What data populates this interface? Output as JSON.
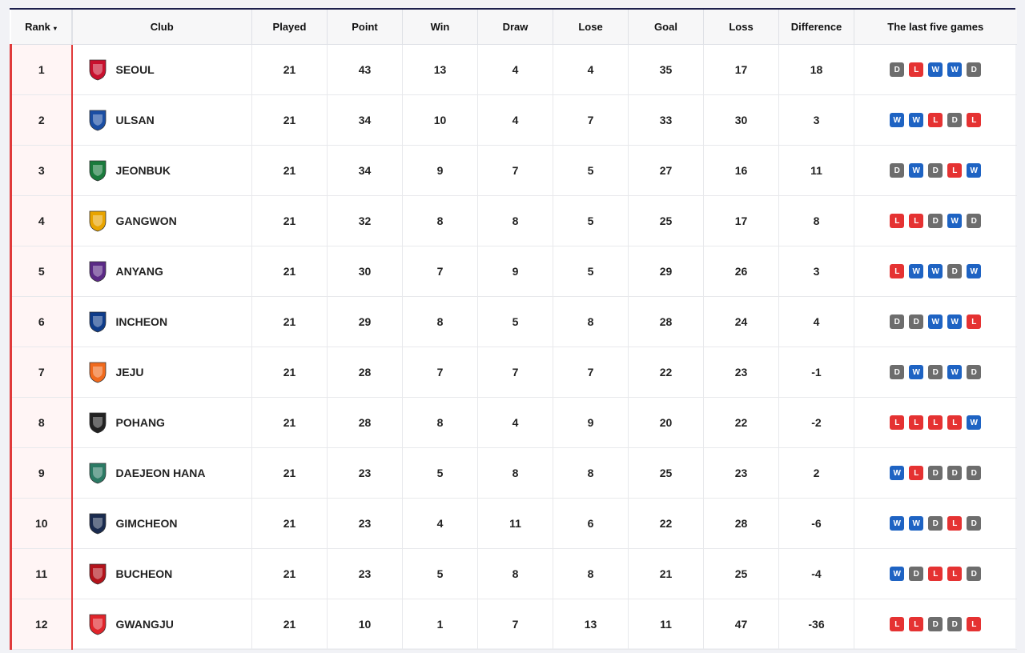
{
  "headers": {
    "rank": "Rank",
    "club": "Club",
    "played": "Played",
    "point": "Point",
    "win": "Win",
    "draw": "Draw",
    "lose": "Lose",
    "goal": "Goal",
    "loss": "Loss",
    "difference": "Difference",
    "form": "The last five games"
  },
  "sort_indicator": "▾",
  "colors": {
    "win": "#1e63c3",
    "loss": "#e53232",
    "draw": "#6d6d6d",
    "accent": "#e03a3a"
  },
  "rows": [
    {
      "rank": "1",
      "club": "SEOUL",
      "crest": "seoul-crest-icon",
      "crest_color": "#c8102e",
      "played": "21",
      "point": "43",
      "win": "13",
      "draw": "4",
      "lose": "4",
      "goal": "35",
      "loss": "17",
      "diff": "18",
      "form": [
        "D",
        "L",
        "W",
        "W",
        "D"
      ]
    },
    {
      "rank": "2",
      "club": "ULSAN",
      "crest": "ulsan-crest-icon",
      "crest_color": "#1b4ea3",
      "played": "21",
      "point": "34",
      "win": "10",
      "draw": "4",
      "lose": "7",
      "goal": "33",
      "loss": "30",
      "diff": "3",
      "form": [
        "W",
        "W",
        "L",
        "D",
        "L"
      ]
    },
    {
      "rank": "3",
      "club": "JEONBUK",
      "crest": "jeonbuk-crest-icon",
      "crest_color": "#1a7a3c",
      "played": "21",
      "point": "34",
      "win": "9",
      "draw": "7",
      "lose": "5",
      "goal": "27",
      "loss": "16",
      "diff": "11",
      "form": [
        "D",
        "W",
        "D",
        "L",
        "W"
      ]
    },
    {
      "rank": "4",
      "club": "GANGWON",
      "crest": "gangwon-crest-icon",
      "crest_color": "#e8a400",
      "played": "21",
      "point": "32",
      "win": "8",
      "draw": "8",
      "lose": "5",
      "goal": "25",
      "loss": "17",
      "diff": "8",
      "form": [
        "L",
        "L",
        "D",
        "W",
        "D"
      ]
    },
    {
      "rank": "5",
      "club": "ANYANG",
      "crest": "anyang-crest-icon",
      "crest_color": "#5b2a86",
      "played": "21",
      "point": "30",
      "win": "7",
      "draw": "9",
      "lose": "5",
      "goal": "29",
      "loss": "26",
      "diff": "3",
      "form": [
        "L",
        "W",
        "W",
        "D",
        "W"
      ]
    },
    {
      "rank": "6",
      "club": "INCHEON",
      "crest": "incheon-crest-icon",
      "crest_color": "#0f3c8a",
      "played": "21",
      "point": "29",
      "win": "8",
      "draw": "5",
      "lose": "8",
      "goal": "28",
      "loss": "24",
      "diff": "4",
      "form": [
        "D",
        "D",
        "W",
        "W",
        "L"
      ]
    },
    {
      "rank": "7",
      "club": "JEJU",
      "crest": "jeju-crest-icon",
      "crest_color": "#f06a1d",
      "played": "21",
      "point": "28",
      "win": "7",
      "draw": "7",
      "lose": "7",
      "goal": "22",
      "loss": "23",
      "diff": "-1",
      "form": [
        "D",
        "W",
        "D",
        "W",
        "D"
      ]
    },
    {
      "rank": "8",
      "club": "POHANG",
      "crest": "pohang-crest-icon",
      "crest_color": "#222222",
      "played": "21",
      "point": "28",
      "win": "8",
      "draw": "4",
      "lose": "9",
      "goal": "20",
      "loss": "22",
      "diff": "-2",
      "form": [
        "L",
        "L",
        "L",
        "L",
        "W"
      ]
    },
    {
      "rank": "9",
      "club": "DAEJEON HANA",
      "crest": "daejeon-crest-icon",
      "crest_color": "#2b7a64",
      "played": "21",
      "point": "23",
      "win": "5",
      "draw": "8",
      "lose": "8",
      "goal": "25",
      "loss": "23",
      "diff": "2",
      "form": [
        "W",
        "L",
        "D",
        "D",
        "D"
      ]
    },
    {
      "rank": "10",
      "club": "GIMCHEON",
      "crest": "gimcheon-crest-icon",
      "crest_color": "#1a2b4f",
      "played": "21",
      "point": "23",
      "win": "4",
      "draw": "11",
      "lose": "6",
      "goal": "22",
      "loss": "28",
      "diff": "-6",
      "form": [
        "W",
        "W",
        "D",
        "L",
        "D"
      ]
    },
    {
      "rank": "11",
      "club": "BUCHEON",
      "crest": "bucheon-crest-icon",
      "crest_color": "#b3131b",
      "played": "21",
      "point": "23",
      "win": "5",
      "draw": "8",
      "lose": "8",
      "goal": "21",
      "loss": "25",
      "diff": "-4",
      "form": [
        "W",
        "D",
        "L",
        "L",
        "D"
      ]
    },
    {
      "rank": "12",
      "club": "GWANGJU",
      "crest": "gwangju-crest-icon",
      "crest_color": "#e0242b",
      "played": "21",
      "point": "10",
      "win": "1",
      "draw": "7",
      "lose": "13",
      "goal": "11",
      "loss": "47",
      "diff": "-36",
      "form": [
        "L",
        "L",
        "D",
        "D",
        "L"
      ]
    }
  ]
}
